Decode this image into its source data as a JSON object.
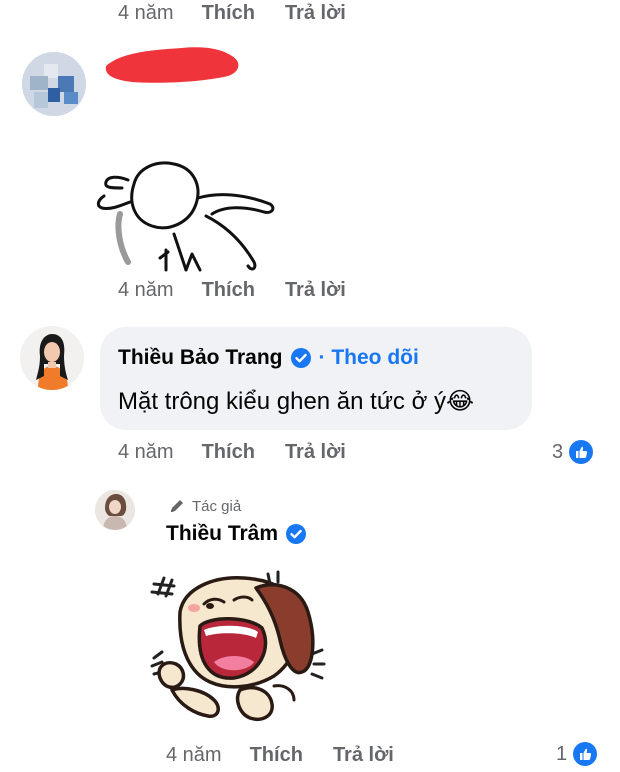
{
  "comments": [
    {
      "age": "4 năm",
      "like_label": "Thích",
      "reply_label": "Trả lời"
    },
    {
      "name_redacted": true,
      "age": "4 năm",
      "like_label": "Thích",
      "reply_label": "Trả lời",
      "sticker": "rabbit-sticker"
    },
    {
      "name": "Thiều Bảo Trang",
      "follow_label": "· Theo dõi",
      "text": "Mặt trông kiểu ghen ăn tức ở ý😂",
      "age": "4 năm",
      "like_label": "Thích",
      "reply_label": "Trả lời",
      "reaction_count": "3"
    }
  ],
  "reply": {
    "author_badge": "Tác giả",
    "name": "Thiều Trâm",
    "age": "4 năm",
    "like_label": "Thích",
    "reply_label": "Trả lời",
    "reaction_count": "1",
    "sticker": "laughing-dog-sticker"
  },
  "colors": {
    "accent": "#1877f2",
    "bubble": "#f0f2f5",
    "meta": "#65676b",
    "redaction": "#f0343c"
  }
}
